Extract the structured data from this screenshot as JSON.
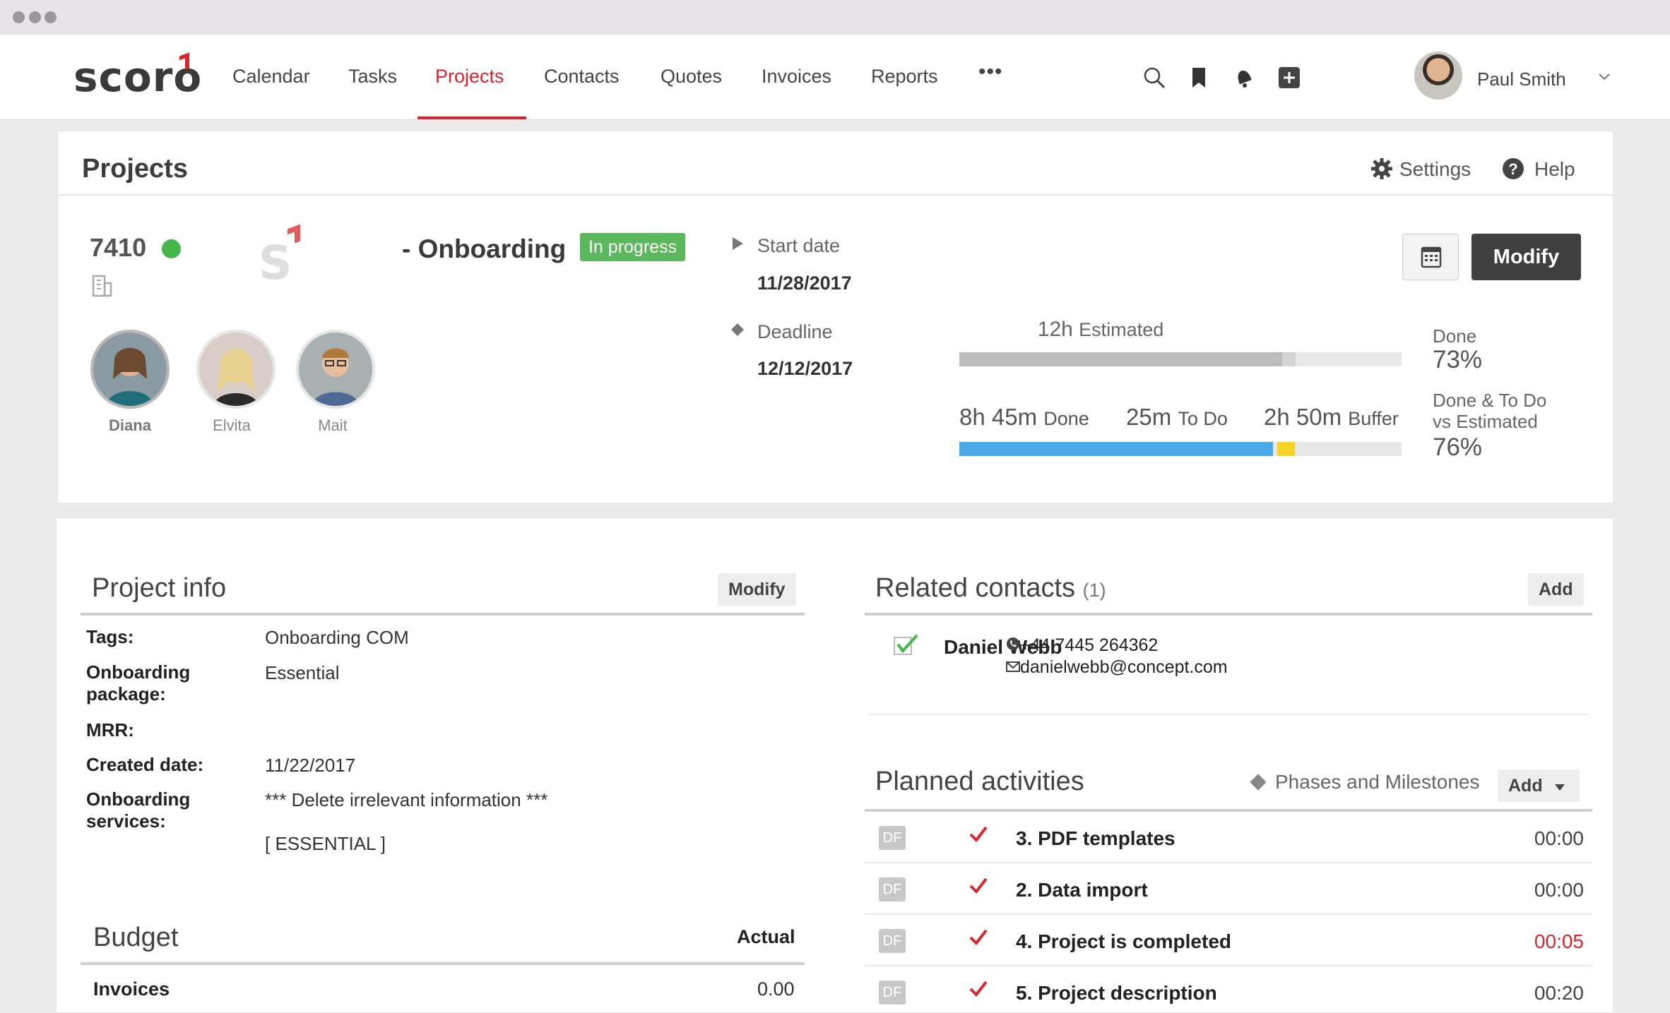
{
  "nav": {
    "logo": "scoro",
    "items": [
      "Calendar",
      "Tasks",
      "Projects",
      "Contacts",
      "Quotes",
      "Invoices",
      "Reports"
    ],
    "active": "Projects",
    "more": "•••",
    "user_name": "Paul Smith"
  },
  "header": {
    "title": "Projects",
    "settings": "Settings",
    "help": "Help"
  },
  "project": {
    "id": "7410",
    "logo_letter": "S",
    "name": "- Onboarding",
    "status": "In progress",
    "modify": "Modify",
    "team": [
      {
        "name": "Diana",
        "selected": true
      },
      {
        "name": "Elvita",
        "selected": false
      },
      {
        "name": "Mait",
        "selected": false
      }
    ],
    "start_label": "Start date",
    "start_value": "11/28/2017",
    "deadline_label": "Deadline",
    "deadline_value": "12/12/2017",
    "estimated_value": "12h",
    "estimated_label": "Estimated",
    "done_time": "8h 45m",
    "done_time_label": "Done",
    "todo_time": "25m",
    "todo_time_label": "To Do",
    "buffer_time": "2h 50m",
    "buffer_time_label": "Buffer",
    "done_label": "Done",
    "done_pct": "73%",
    "vs_label_1": "Done & To Do",
    "vs_label_2": "vs Estimated",
    "vs_pct": "76%",
    "bar1_fill_fraction": 0.73,
    "bar1_light_fraction": 0.76,
    "bar2_done_fraction": 0.71,
    "bar2_todo_fraction": 0.04,
    "colors": {
      "done": "#4aa8e8",
      "todo": "#f5d327",
      "grey": "#bdbdbd",
      "status": "#45b649",
      "accent": "#d9262c"
    }
  },
  "project_info": {
    "title": "Project info",
    "modify": "Modify",
    "rows": [
      {
        "label": "Tags:",
        "value": "Onboarding COM"
      },
      {
        "label": "Onboarding package:",
        "value": "Essential"
      },
      {
        "label": "MRR:",
        "value": ""
      },
      {
        "label": "Created date:",
        "value": "11/22/2017"
      },
      {
        "label": "Onboarding services:",
        "value": "*** Delete irrelevant information ***"
      }
    ],
    "extra_value": "[ ESSENTIAL ]"
  },
  "budget": {
    "title": "Budget",
    "col": "Actual",
    "row_label": "Invoices",
    "row_value": "0.00"
  },
  "contacts": {
    "title": "Related contacts",
    "count": "(1)",
    "add": "Add",
    "name": "Daniel Webb",
    "phone": "+44 7445 264362",
    "email": "danielwebb@concept.com"
  },
  "activities": {
    "title": "Planned activities",
    "filter": "Phases and Milestones",
    "add": "Add",
    "rows": [
      {
        "badge": "DF",
        "name": "3. PDF templates",
        "time": "00:00",
        "late": false
      },
      {
        "badge": "DF",
        "name": "2. Data import",
        "time": "00:00",
        "late": false
      },
      {
        "badge": "DF",
        "name": "4. Project is completed",
        "time": "00:05",
        "late": true
      },
      {
        "badge": "DF",
        "name": "5. Project description",
        "time": "00:20",
        "late": false
      }
    ]
  }
}
